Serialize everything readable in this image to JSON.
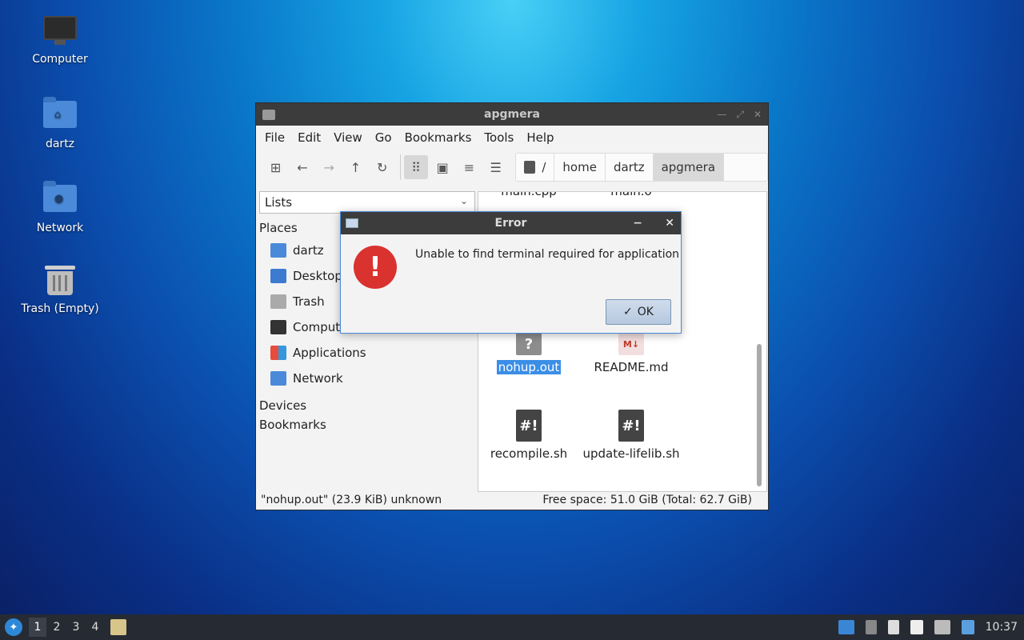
{
  "desktop": {
    "icons": [
      {
        "label": "Computer",
        "icon": "computer-icon"
      },
      {
        "label": "dartz",
        "icon": "home-folder-icon"
      },
      {
        "label": "Network",
        "icon": "network-folder-icon"
      },
      {
        "label": "Trash (Empty)",
        "icon": "trash-icon"
      }
    ]
  },
  "window": {
    "title": "apgmera",
    "menu": [
      "File",
      "Edit",
      "View",
      "Go",
      "Bookmarks",
      "Tools",
      "Help"
    ],
    "toolbar": [
      "new-tab-icon",
      "back-icon",
      "forward-icon",
      "up-icon",
      "reload-icon",
      "icon-view-icon",
      "thumbnail-view-icon",
      "compact-view-icon",
      "detailed-list-icon"
    ],
    "path": {
      "root": "/",
      "segments": [
        "home",
        "dartz",
        "apgmera"
      ]
    },
    "sidebar": {
      "mode": "Lists",
      "places_heading": "Places",
      "places": [
        {
          "label": "dartz",
          "icon": "home-folder-icon"
        },
        {
          "label": "Desktop",
          "icon": "desktop-icon"
        },
        {
          "label": "Trash",
          "icon": "trash-icon"
        },
        {
          "label": "Computer",
          "icon": "computer-icon"
        },
        {
          "label": "Applications",
          "icon": "applications-icon"
        },
        {
          "label": "Network",
          "icon": "network-folder-icon"
        }
      ],
      "devices_heading": "Devices",
      "bookmarks_heading": "Bookmarks"
    },
    "files": [
      {
        "name": "main.cpp",
        "icon": "cpp-file-icon"
      },
      {
        "name": "main.o",
        "icon": "object-file-icon"
      },
      {
        "name": "nohup.out",
        "icon": "unknown-file-icon",
        "selected": true
      },
      {
        "name": "README.md",
        "icon": "markdown-file-icon",
        "glyph": "M↓"
      },
      {
        "name": "recompile.sh",
        "icon": "shell-script-icon",
        "glyph": "#!"
      },
      {
        "name": "update-lifelib.sh",
        "icon": "shell-script-icon",
        "glyph": "#!"
      }
    ],
    "status_left": "\"nohup.out\" (23.9 KiB) unknown",
    "status_right": "Free space: 51.0 GiB (Total: 62.7 GiB)"
  },
  "dialog": {
    "title": "Error",
    "message": "Unable to find terminal required for application",
    "ok_label": "OK",
    "minimize": "−",
    "close": "✕",
    "unknown_glyph": "?"
  },
  "taskbar": {
    "workspaces": [
      "1",
      "2",
      "3",
      "4"
    ],
    "clock": "10:37"
  },
  "colors": {
    "accent": "#3b8ee6",
    "error": "#d9322f",
    "titlebar": "#3c3c3c",
    "taskbar": "#262b33"
  }
}
